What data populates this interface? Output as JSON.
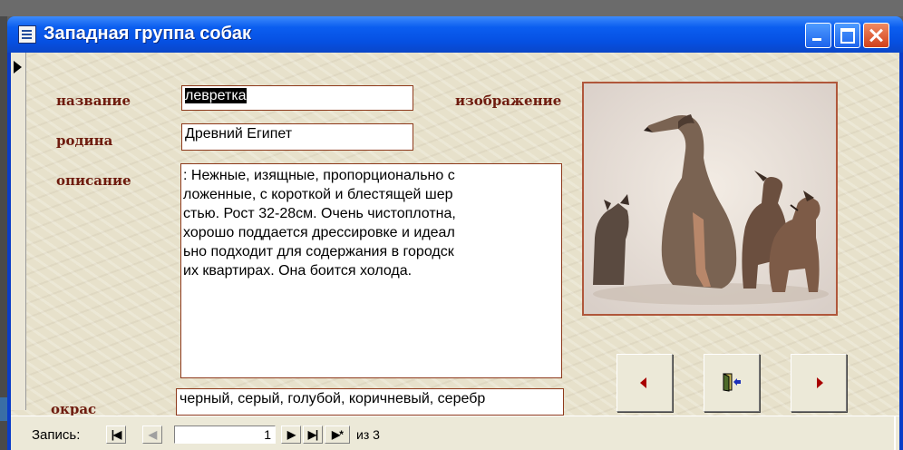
{
  "window": {
    "title": "Западная группа собак",
    "controls": {
      "minimize": "minimize",
      "maximize": "maximize",
      "close": "close"
    }
  },
  "form": {
    "labels": {
      "name": "название",
      "origin": "родина",
      "description": "описание",
      "image": "изображение",
      "color": "окрас"
    },
    "fields": {
      "name": "левретка",
      "origin": "Древний Египет",
      "description": ": Нежные, изящные, пропорционально с\nложенные, с короткой и блестящей шер\nстью. Рост 32-28см. Очень чистоплотна,\nхорошо поддается дрессировке и идеал\nьно подходит для содержания в городск\nих квартирах. Она боится холода.",
      "color": "черный, серый, голубой, коричневый, серебр"
    },
    "buttons": [
      {
        "name": "previous-record",
        "icon": "triangle-left-icon"
      },
      {
        "name": "close-form",
        "icon": "door-exit-icon"
      },
      {
        "name": "next-record",
        "icon": "triangle-right-icon"
      }
    ]
  },
  "record_nav": {
    "label": "Запись:",
    "current": "1",
    "of_label": "из",
    "total": "3",
    "first_glyph": "|◀",
    "prev_glyph": "◀",
    "next_glyph": "▶",
    "last_glyph": "▶|",
    "new_glyph": "▶*"
  },
  "colors": {
    "label_text": "#6e1b0e",
    "field_border": "#8e3a1c",
    "nav_arrow": "#a80000",
    "titlebar": "#0650e2",
    "form_background": "#e7e1cb"
  }
}
